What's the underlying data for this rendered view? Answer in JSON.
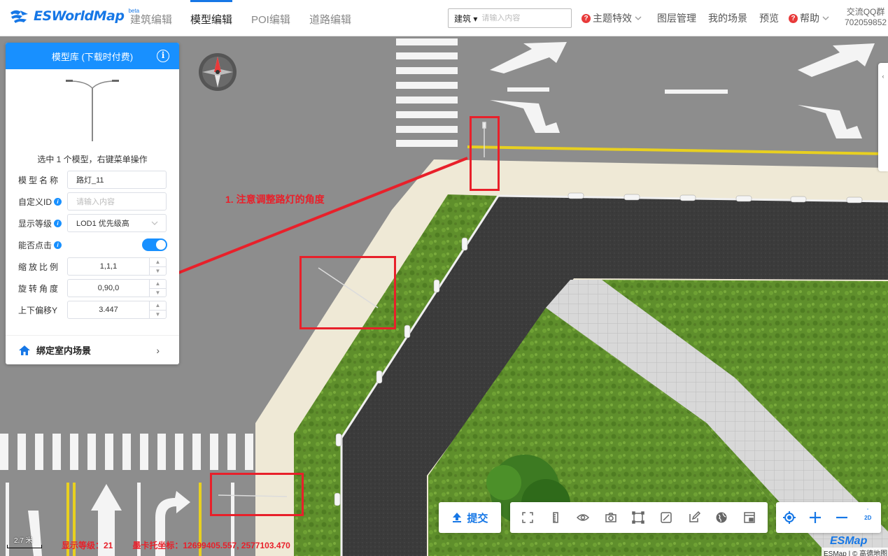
{
  "header": {
    "logo_text": "ESWorldMap",
    "logo_sup": "beta",
    "nav": [
      "建筑编辑",
      "模型编辑",
      "POI编辑",
      "道路编辑"
    ],
    "search_type": "建筑 ▾",
    "search_placeholder": "请输入内容",
    "theme_effects": "主题特效",
    "layer_manage": "图层管理",
    "my_scene": "我的场景",
    "preview": "预览",
    "help": "帮助",
    "qq_label": "交流QQ群",
    "qq_number": "702059852"
  },
  "panel": {
    "title": "模型库 (下载时付费)",
    "selection_text": "选中 1 个模型，右键菜单操作",
    "model_name_label": "模型名称",
    "model_name_value": "路灯_11",
    "custom_id_label": "自定义ID",
    "custom_id_placeholder": "请输入内容",
    "display_level_label": "显示等级",
    "display_level_value": "LOD1 优先级高",
    "clickable_label": "能否点击",
    "scale_label": "缩放比例",
    "scale_value": "1,1,1",
    "rotation_label": "旋转角度",
    "rotation_value": "0,90,0",
    "offset_label": "上下偏移Y",
    "offset_value": "3.447",
    "bind_indoor": "绑定室内场景"
  },
  "annotation": "1. 注意调整路灯的角度",
  "toolbar": {
    "submit": "提交",
    "mode": "2D"
  },
  "status": {
    "scale_label": "2.7 米",
    "display_level": "显示等级：21",
    "mercator": "墨卡托坐标：12699405.557, 2577103.470"
  },
  "footer": {
    "brand": "ESMap",
    "copyright": "ESMap | © 高德地图"
  },
  "colors": {
    "accent": "#1890ff",
    "annotation": "#e8202a",
    "road": "#3a3a3a",
    "grass": "#5a8a2a"
  }
}
